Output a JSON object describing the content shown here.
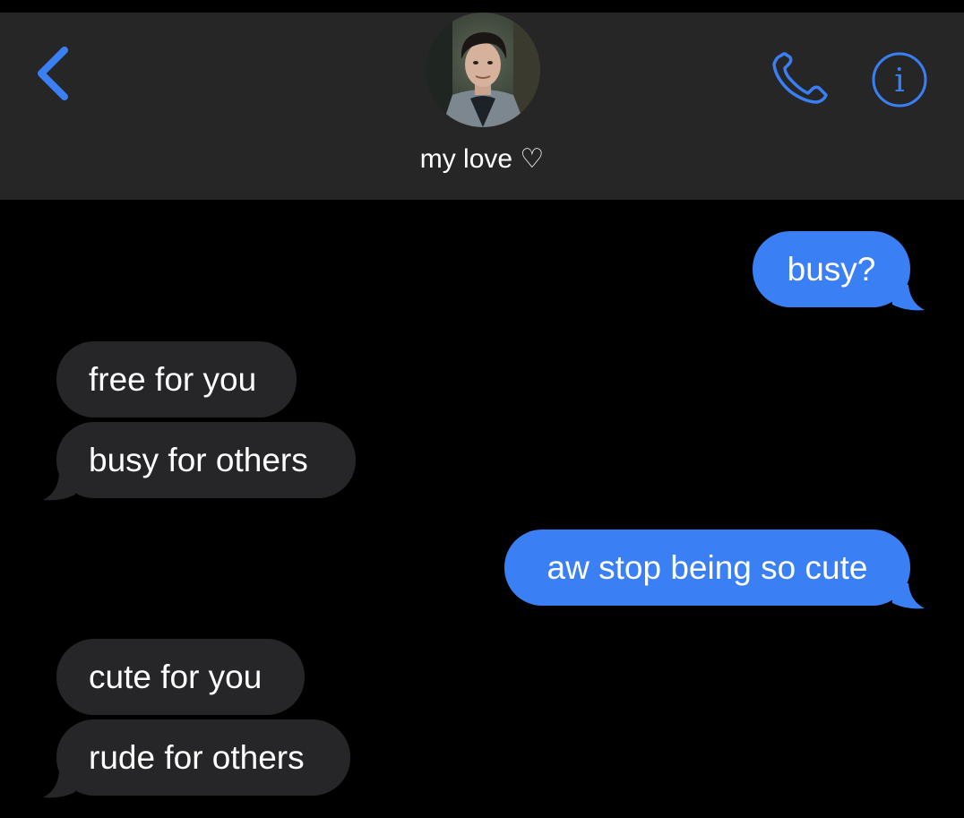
{
  "header": {
    "contact_name": "my love ♡",
    "back_icon": "chevron-left-icon",
    "phone_icon": "phone-icon",
    "info_icon": "info-icon",
    "accent_color": "#3a7ff3",
    "background_color": "#262626"
  },
  "messages": [
    {
      "direction": "sent",
      "text": "busy?"
    },
    {
      "direction": "received",
      "text": "free for you"
    },
    {
      "direction": "received",
      "text": "busy for others"
    },
    {
      "direction": "sent",
      "text": "aw stop being so cute"
    },
    {
      "direction": "received",
      "text": "cute for you"
    },
    {
      "direction": "received",
      "text": "rude for others"
    }
  ],
  "colors": {
    "sent_bubble": "#3a7ff3",
    "received_bubble": "#262628",
    "background": "#000000"
  }
}
